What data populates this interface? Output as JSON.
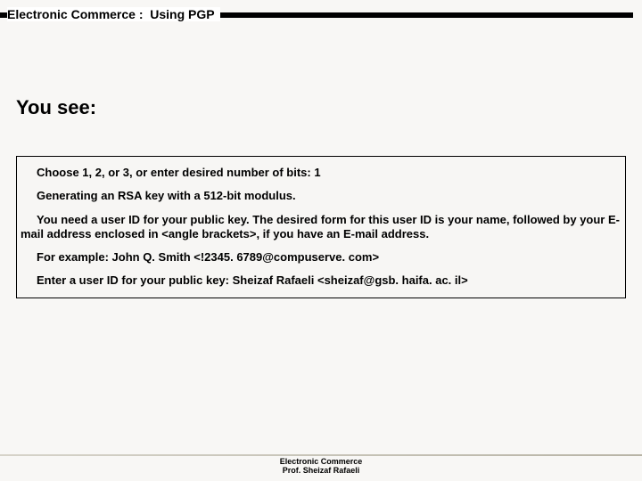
{
  "header": {
    "title": "Electronic Commerce :  Using PGP"
  },
  "section": {
    "title": "You see:"
  },
  "content": {
    "p1": "Choose 1, 2, or 3, or enter desired number of bits: 1",
    "p2": "Generating an RSA key with a 512-bit modulus.",
    "p3": "You need a user ID for your public key.  The desired form for                       this user ID is your name, followed by your E-mail address                          enclosed in <angle brackets>, if you have an E-mail address.",
    "p4": "For example:  John Q. Smith <!2345. 6789@compuserve. com>",
    "p5": "Enter a user ID for your public key:                 Sheizaf Rafaeli <sheizaf@gsb. haifa. ac. il>"
  },
  "footer": {
    "line1": "Electronic Commerce",
    "line2": "Prof. Sheizaf Rafaeli"
  }
}
